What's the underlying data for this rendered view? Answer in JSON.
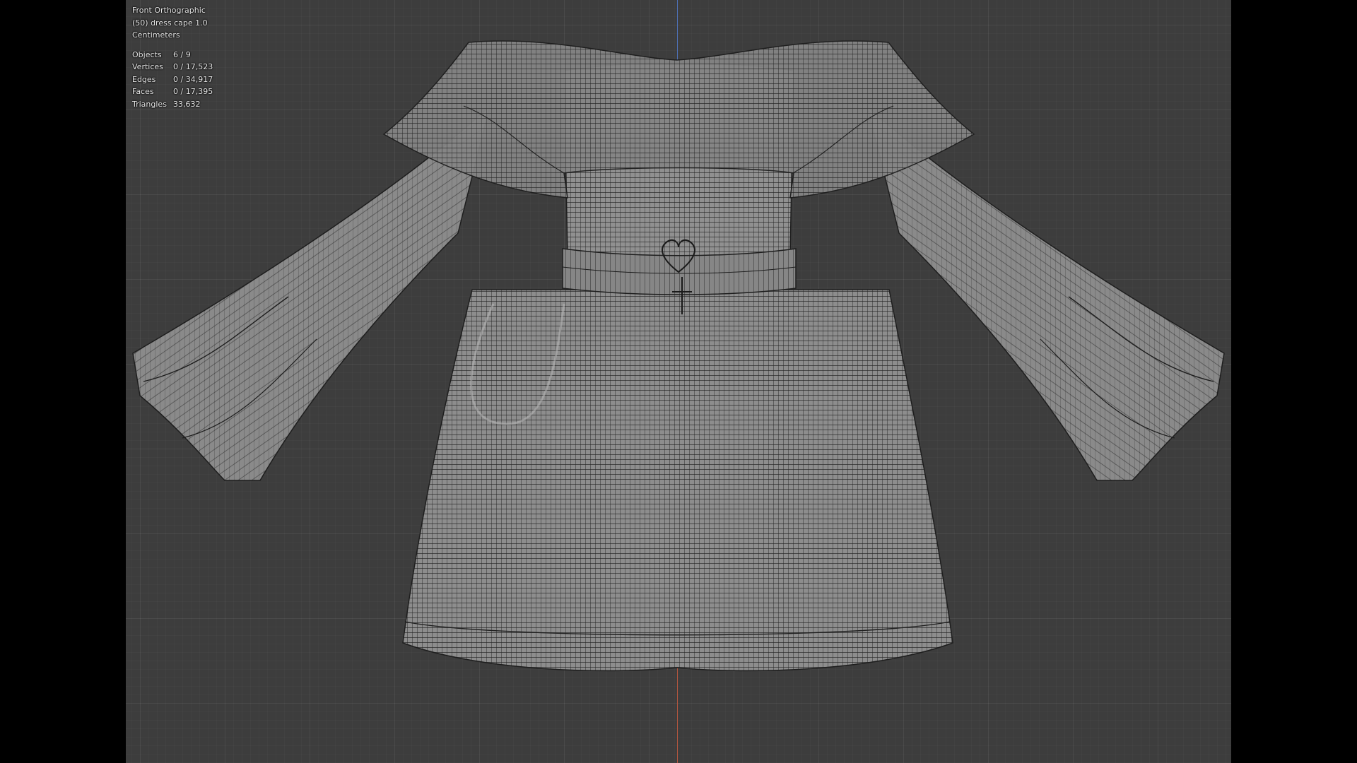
{
  "viewport": {
    "view_name": "Front Orthographic",
    "object_label": "(50) dress cape 1.0",
    "units": "Centimeters"
  },
  "stats": [
    {
      "label": "Objects",
      "value": "6 / 9"
    },
    {
      "label": "Vertices",
      "value": "0 / 17,523"
    },
    {
      "label": "Edges",
      "value": "0 / 34,917"
    },
    {
      "label": "Faces",
      "value": "0 / 17,395"
    },
    {
      "label": "Triangles",
      "value": "33,632"
    }
  ],
  "colors": {
    "viewport_bg": "#3d3d3d",
    "mesh_fill": "#8a8a8a",
    "wire": "#1e1e1e",
    "axis_z_positive": "#4f72b8",
    "axis_z_negative": "#b5563f"
  }
}
